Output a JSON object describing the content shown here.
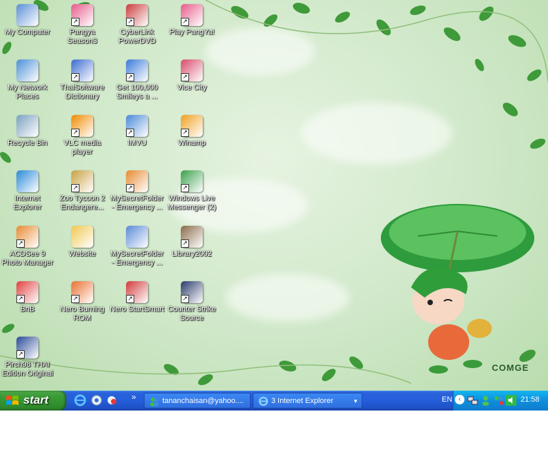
{
  "desktop": {
    "icons": [
      {
        "label": "My Computer",
        "icon": "my-computer-icon"
      },
      {
        "label": "Pangya Season3",
        "icon": "pangya-icon"
      },
      {
        "label": "CyberLink PowerDVD",
        "icon": "powerdvd-icon"
      },
      {
        "label": "Play PangYa!",
        "icon": "pangya-icon"
      },
      {
        "label": "My Network Places",
        "icon": "network-places-icon"
      },
      {
        "label": "ThaiSoftware Dictionary",
        "icon": "dictionary-icon"
      },
      {
        "label": "Get 100,000 Smileys a ...",
        "icon": "smileys-icon"
      },
      {
        "label": "Vice City",
        "icon": "vice-city-icon"
      },
      {
        "label": "Recycle Bin",
        "icon": "recycle-bin-icon"
      },
      {
        "label": "VLC media player",
        "icon": "vlc-icon"
      },
      {
        "label": "IMVU",
        "icon": "imvu-icon"
      },
      {
        "label": "Winamp",
        "icon": "winamp-icon"
      },
      {
        "label": "Internet Explorer",
        "icon": "internet-explorer-icon"
      },
      {
        "label": "Zoo Tycoon 2 Endangere...",
        "icon": "zoo-tycoon-icon"
      },
      {
        "label": "MySecretFolder - Emergency ...",
        "icon": "secret-folder-icon"
      },
      {
        "label": "Windows Live Messenger (2)",
        "icon": "messenger-icon"
      },
      {
        "label": "ACDSee 9 Photo Manager",
        "icon": "acdsee-icon"
      },
      {
        "label": "Website",
        "icon": "folder-icon"
      },
      {
        "label": "MySecretFolder - Emergency ...",
        "icon": "document-icon"
      },
      {
        "label": "Library2002",
        "icon": "library-icon"
      },
      {
        "label": "BnB",
        "icon": "bnb-icon"
      },
      {
        "label": "Nero Burning ROM",
        "icon": "nero-burning-icon"
      },
      {
        "label": "Nero StartSmart",
        "icon": "nero-startsmart-icon"
      },
      {
        "label": "Counter Strike Source",
        "icon": "counter-strike-icon"
      },
      {
        "label": "Pirch98 THAI Edition Original",
        "icon": "pirch-icon"
      }
    ],
    "watermark": "COMGE"
  },
  "taskbar": {
    "start_label": "start",
    "quick_launch": [
      "internet-explorer-icon",
      "media-icon",
      "messenger-icon"
    ],
    "overflow": "»",
    "tasks": [
      {
        "label": "tananchaisan@yahoo....",
        "icon": "messenger-icon"
      },
      {
        "label": "3 Internet Explorer",
        "icon": "internet-explorer-icon"
      }
    ],
    "tray": {
      "language": "EN",
      "time": "21:58"
    }
  },
  "colors": {
    "taskbar_blue": "#245edb",
    "start_green": "#3a9b36",
    "tray_blue": "#0f8fdd"
  }
}
